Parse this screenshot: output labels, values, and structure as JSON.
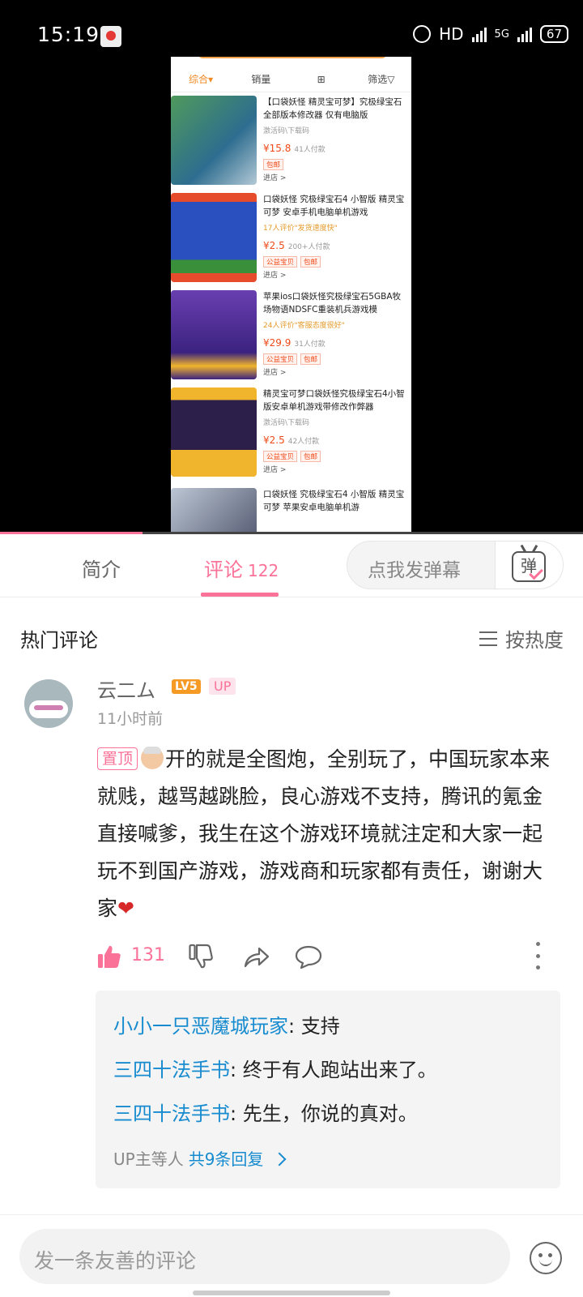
{
  "status_bar": {
    "time": "15:19",
    "hd": "HD",
    "network": "5G",
    "battery": "67"
  },
  "video": {
    "filters": [
      "综合▾",
      "销量",
      "⊞",
      "筛选▽"
    ],
    "progress_fraction": 0.245,
    "items": [
      {
        "title": "【口袋妖怪 精灵宝可梦】究极绿宝石全部版本修改器 仅有电脑版",
        "sub": "激活码\\下载码",
        "price": "¥15.8",
        "sold": "41人付款",
        "tags": [
          "包邮"
        ],
        "shop": "进店 >"
      },
      {
        "title": "口袋妖怪 究极绿宝石4 小智版 精灵宝可梦 安卓手机电脑单机游戏",
        "sub": "17人评价\"发货速度快\"",
        "price": "¥2.5",
        "sold": "200+人付款",
        "tags": [
          "公益宝贝",
          "包邮"
        ],
        "shop": "进店 >"
      },
      {
        "title": "苹果ios口袋妖怪究极绿宝石5GBA牧场物语NDSFC重装机兵游戏模",
        "sub": "24人评价\"客服态度很好\"",
        "price": "¥29.9",
        "sold": "31人付款",
        "tags": [
          "公益宝贝",
          "包邮"
        ],
        "shop": "进店 >"
      },
      {
        "title": "精灵宝可梦口袋妖怪究极绿宝石4小智版安卓单机游戏带修改作弊器",
        "sub": "激活码\\下载码",
        "price": "¥2.5",
        "sold": "42人付款",
        "tags": [
          "公益宝贝",
          "包邮"
        ],
        "shop": "进店 >"
      },
      {
        "title": "口袋妖怪 究极绿宝石4 小智版 精灵宝可梦 苹果安卓电脑单机游",
        "sub": "",
        "price": "",
        "sold": "",
        "tags": [],
        "shop": ""
      }
    ]
  },
  "tabs": {
    "intro": "简介",
    "comments": "评论",
    "comments_count": "122",
    "danmaku_placeholder": "点我发弹幕",
    "danmaku_icon_char": "弹"
  },
  "comments_header": {
    "title": "热门评论",
    "sort": "按热度"
  },
  "comment": {
    "username": "云二ム",
    "level": "LV5",
    "up_badge": "UP",
    "time": "11小时前",
    "pinned": "置顶",
    "text": "开的就是全图炮，全别玩了，中国玩家本来就贱，越骂越跳脸，良心游戏不支持，腾讯的氪金直接喊爹，我生在这个游戏环境就注定和大家一起玩不到国产游戏，游戏商和玩家都有责任，谢谢大家",
    "heart": "❤",
    "likes": "131",
    "replies": [
      {
        "name": "小小一只恶魔城玩家",
        "text": ": 支持"
      },
      {
        "name": "三四十法手书",
        "text": ": 终于有人跑站出来了。"
      },
      {
        "name": "三四十法手书",
        "text": ": 先生，你说的真对。"
      }
    ],
    "reply_more_prefix": "UP主等人",
    "reply_more_link": "共9条回复"
  },
  "bottom": {
    "placeholder": "发一条友善的评论"
  },
  "colors": {
    "accent": "#fb7299",
    "link": "#178bcf",
    "price": "#f04a1a"
  }
}
